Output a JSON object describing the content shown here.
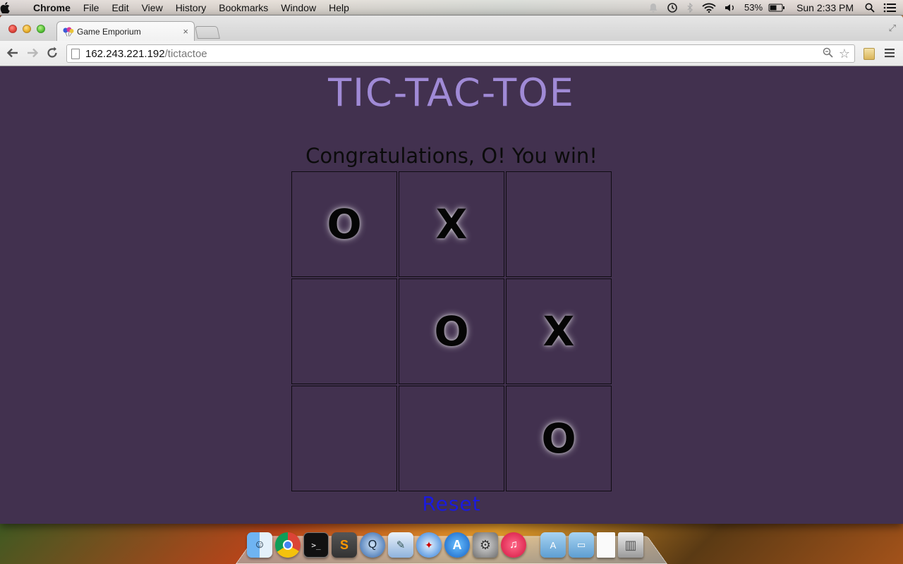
{
  "menubar": {
    "app_name": "Chrome",
    "items": [
      "File",
      "Edit",
      "View",
      "History",
      "Bookmarks",
      "Window",
      "Help"
    ],
    "battery": "53%",
    "clock": "Sun 2:33 PM"
  },
  "browser": {
    "tab_title": "Game Emporium",
    "tab_close": "×",
    "url_host": "162.243.221.192",
    "url_path": "/tictactoe"
  },
  "game": {
    "title": "TIC-TAC-TOE",
    "status": "Congratulations, O! You win!",
    "board": [
      [
        "O",
        "X",
        ""
      ],
      [
        "",
        "O",
        "X"
      ],
      [
        "",
        "",
        "O"
      ]
    ],
    "reset_label": "Reset",
    "colors": {
      "background": "#42314f",
      "title": "#a08ad6",
      "reset": "#1a1adf"
    }
  },
  "dock": {
    "apps": [
      "finder-icon",
      "chrome-icon",
      "terminal-icon",
      "sublime-icon",
      "quicktime-icon",
      "preview-icon",
      "safari-icon",
      "app-store-icon",
      "system-preferences-icon",
      "itunes-icon",
      "applications-folder-icon",
      "documents-folder-icon",
      "file-icon",
      "trash-icon"
    ]
  }
}
